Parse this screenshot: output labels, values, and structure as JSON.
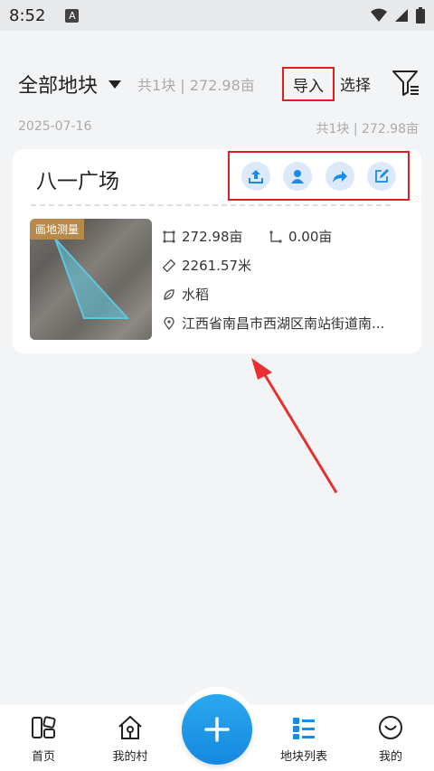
{
  "status_bar": {
    "time": "8:52",
    "badge": "A"
  },
  "header": {
    "title": "全部地块",
    "summary": "共1块 | 272.98亩",
    "import_label": "导入",
    "select_label": "选择"
  },
  "date_row": {
    "date": "2025-07-16",
    "summary": "共1块 | 272.98亩"
  },
  "card": {
    "name": "八一广场",
    "thumb_badge": "画地测量",
    "area": "272.98亩",
    "secondary_area": "0.00亩",
    "perimeter": "2261.57米",
    "crop": "水稻",
    "address": "江西省南昌市西湖区南站街道南..."
  },
  "bottom_nav": {
    "home": "首页",
    "village": "我的村",
    "plots": "地块列表",
    "mine": "我的"
  },
  "colors": {
    "accent": "#1a8be6",
    "highlight": "#e02020",
    "icon_bg": "#dbe9fb"
  }
}
